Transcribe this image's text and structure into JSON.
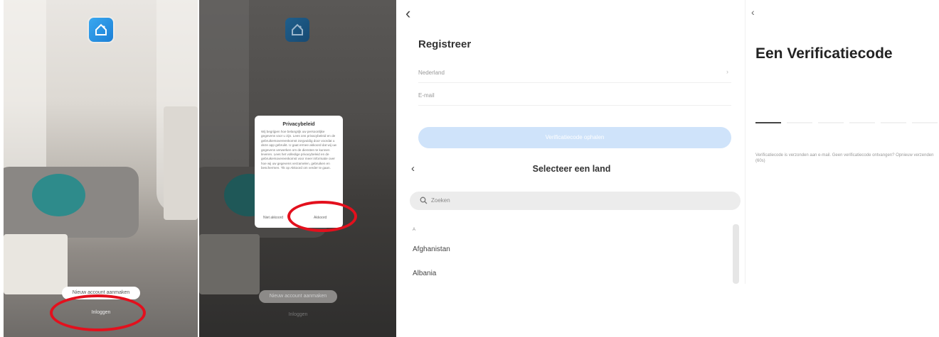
{
  "panel1": {
    "primary_button": "Nieuw account aanmaken",
    "secondary_link": "Inloggen"
  },
  "panel2": {
    "primary_button": "Nieuw account aanmaken",
    "secondary_link": "Inloggen",
    "dialog": {
      "title": "Privacybeleid",
      "body": "Wij begrijpen hoe belangrijk uw persoonlijke gegevens voor u zijn. Lees ons privacybeleid en de gebruikersovereenkomst zorgvuldig door voordat u deze app gebruikt. U gaat ermee akkoord dat wij uw gegevens verwerken om de diensten te kunnen leveren. Lees het volledige privacybeleid en de gebruikersovereenkomst voor meer informatie over hoe wij uw gegevens verzamelen, gebruiken en beschermen. Tik op Akkoord om verder te gaan.",
      "decline": "Niet akkoord",
      "accept": "Akkoord"
    }
  },
  "panel3": {
    "title": "Registreer",
    "country_field": "Nederland",
    "account_placeholder": "E-mail",
    "get_code_button": "Verificatiecode ophalen",
    "country_sheet": {
      "title": "Selecteer een land",
      "search_placeholder": "Zoeken",
      "index_letter": "A",
      "countries": [
        "Afghanistan",
        "Albania"
      ]
    }
  },
  "panel4": {
    "title": "Een Verificatiecode",
    "note": "Verificatiecode is verzonden aan e-mail. Geen verificatiecode ontvangen? Opnieuw verzenden (60s)"
  },
  "colors": {
    "annotation_ring": "#e3101d",
    "brand_blue": "#1c7fd6",
    "primary_light": "#cfe3fa"
  }
}
